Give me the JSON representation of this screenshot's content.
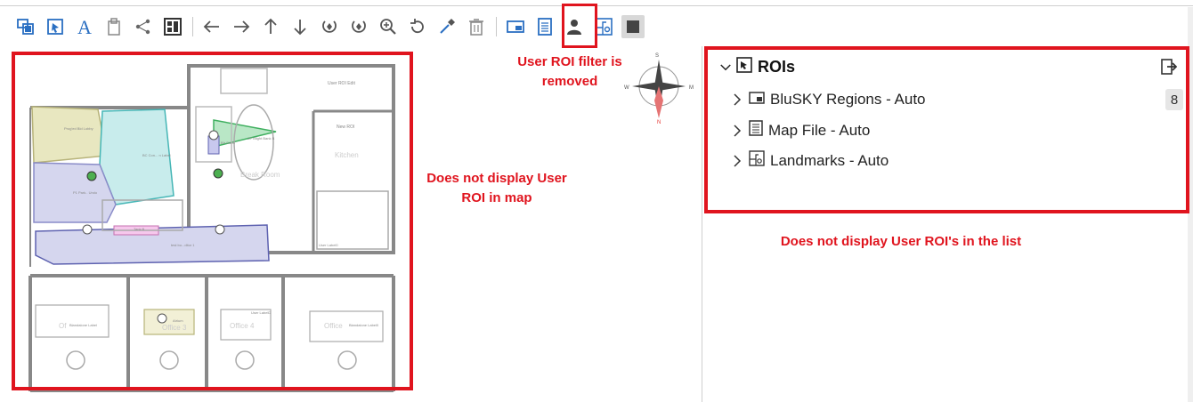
{
  "toolbar": {
    "icons": [
      "layer-icon",
      "select-icon",
      "text-icon",
      "paste-icon",
      "share-icon",
      "grid-icon",
      "arrow-left-icon",
      "arrow-right-icon",
      "arrow-up-icon",
      "arrow-down-icon",
      "rotate-cw-icon",
      "rotate-ccw-icon",
      "zoom-icon",
      "reset-icon",
      "eyedropper-icon",
      "trash-icon",
      "region-icon",
      "map-file-icon",
      "user-icon",
      "landmark-icon",
      "stop-icon"
    ],
    "active_icon": "stop-icon",
    "highlighted_icon": "user-icon"
  },
  "map": {
    "labels": {
      "user_roi_edit": "User ROI Edit",
      "new_roi": "New ROI",
      "kitchen": "Kitchen",
      "break_room": "Break Room",
      "zone_a": "Prog'ed Bld Lobby",
      "zone_b": "BC Con... n Label",
      "zone_c": "P1 Park.. Undo",
      "zone_d": "D7 Blight Bank B",
      "zone_e": "BIr Sid B",
      "zone_f": "Tank B",
      "zone_g": "test bo...ditor 1",
      "user_label_0": "User Label0",
      "user_label_d": "User LabelD",
      "blandalone_label": "Blandalone Label",
      "blandalone_label0": "Blandalone Label0",
      "atrium": "Atrium",
      "office_3": "Office 3",
      "office_4": "Office 4",
      "office_5": "Office",
      "office_2": "Of"
    },
    "compass": {
      "n_top": "S",
      "n_bottom": "N",
      "e": "M",
      "w": "W"
    }
  },
  "annotations": {
    "filter_removed": "User ROI filter is removed",
    "map_note": "Does not display User ROI in map",
    "list_note": "Does not display User ROI's in the list"
  },
  "roi_panel": {
    "title": "ROIs",
    "items": [
      {
        "label": "BluSKY Regions - Auto",
        "icon": "region-icon",
        "count": "8"
      },
      {
        "label": "Map File - Auto",
        "icon": "map-file-icon"
      },
      {
        "label": "Landmarks - Auto",
        "icon": "landmark-icon"
      }
    ]
  },
  "colors": {
    "accent": "#2a6fc2",
    "highlight": "#e0141e"
  }
}
